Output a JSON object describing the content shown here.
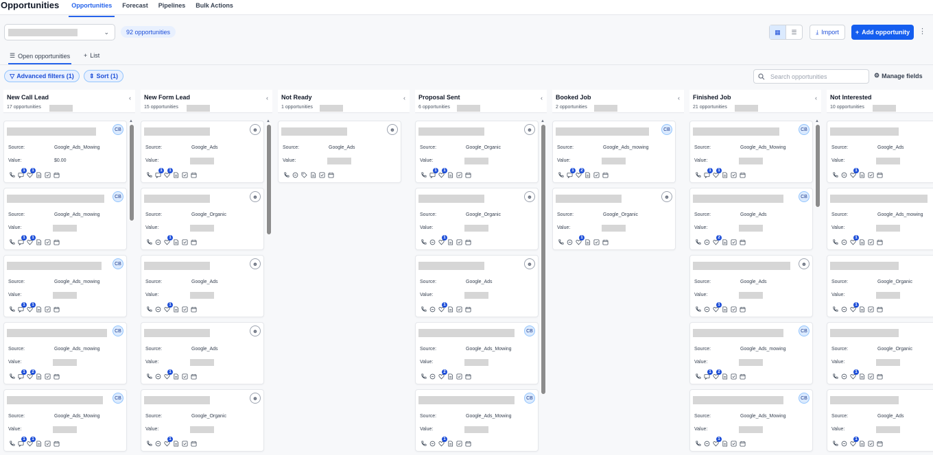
{
  "page_title": "Opportunities",
  "nav_tabs": [
    "Opportunities",
    "Forecast",
    "Pipelines",
    "Bulk Actions"
  ],
  "toolbar": {
    "opportunity_count": "92 opportunities",
    "import_label": "Import",
    "add_label": "Add opportunity"
  },
  "subtabs": {
    "open": "Open opportunities",
    "list": "List"
  },
  "filters": {
    "advanced": "Advanced filters (1)",
    "sort": "Sort (1)",
    "search_placeholder": "Search opportunities",
    "manage": "Manage fields"
  },
  "labels": {
    "source": "Source:",
    "value": "Value:"
  },
  "columns": [
    {
      "name": "New Call Lead",
      "count": "17 opportunities",
      "cards": [
        {
          "avatar": "CB",
          "source": "Google_Ads_Mowing",
          "value": "$0.00",
          "icons": [
            "phone",
            "msg",
            "heart",
            "doc",
            "check",
            "cal"
          ],
          "badges": {
            "msg": "1",
            "heart": "1"
          }
        },
        {
          "avatar": "CB",
          "source": "Google_Ads_mowing",
          "value": "",
          "icons": [
            "phone",
            "msg",
            "heart",
            "doc",
            "check",
            "cal"
          ],
          "badges": {
            "msg": "1",
            "heart": "1"
          }
        },
        {
          "avatar": "CB",
          "source": "Google_Ads_mowing",
          "value": "",
          "icons": [
            "phone",
            "msg",
            "heart",
            "doc",
            "check",
            "cal"
          ],
          "badges": {
            "msg": "1",
            "heart": "1"
          }
        },
        {
          "avatar": "CB",
          "source": "Google_Ads_mowing",
          "value": "",
          "icons": [
            "phone",
            "msg",
            "heart",
            "doc",
            "check",
            "cal"
          ],
          "badges": {
            "msg": "1",
            "heart": "2"
          }
        },
        {
          "avatar": "CB",
          "source": "Google_Ads_Mowing",
          "value": "",
          "icons": [
            "phone",
            "msg",
            "heart",
            "doc",
            "check",
            "cal"
          ],
          "badges": {
            "msg": "1",
            "heart": "1"
          }
        }
      ]
    },
    {
      "name": "New Form Lead",
      "count": "15 opportunities",
      "cards": [
        {
          "avatar": "person",
          "source": "Google_Ads",
          "value": "",
          "icons": [
            "phone",
            "msg",
            "heart",
            "doc",
            "check",
            "cal"
          ],
          "badges": {
            "msg": "1",
            "heart": "1"
          }
        },
        {
          "avatar": "person",
          "source": "Google_Organic",
          "value": "",
          "icons": [
            "phone",
            "chat",
            "heart",
            "doc",
            "check",
            "cal"
          ],
          "badges": {
            "heart": "1"
          }
        },
        {
          "avatar": "person",
          "source": "Google_Ads",
          "value": "",
          "icons": [
            "phone",
            "chat",
            "heart",
            "doc",
            "check",
            "cal"
          ],
          "badges": {
            "heart": "1"
          }
        },
        {
          "avatar": "person",
          "source": "Google_Ads",
          "value": "",
          "icons": [
            "phone",
            "chat",
            "heart",
            "doc",
            "check",
            "cal"
          ],
          "badges": {
            "heart": "1"
          }
        },
        {
          "avatar": "person",
          "source": "Google_Organic",
          "value": "",
          "icons": [
            "phone",
            "chat",
            "heart",
            "doc",
            "check",
            "cal"
          ],
          "badges": {
            "heart": "1"
          }
        }
      ]
    },
    {
      "name": "Not Ready",
      "count": "1 opportunities",
      "cards": [
        {
          "avatar": "person",
          "source": "Google_Ads",
          "value": "",
          "icons": [
            "phone",
            "chat",
            "tag",
            "doc",
            "check",
            "cal"
          ],
          "badges": {}
        }
      ]
    },
    {
      "name": "Proposal Sent",
      "count": "6 opportunities",
      "cards": [
        {
          "avatar": "person",
          "source": "Google_Organic",
          "value": "",
          "icons": [
            "phone",
            "msg",
            "heart",
            "doc",
            "check",
            "cal"
          ],
          "badges": {
            "msg": "1",
            "heart": "1"
          }
        },
        {
          "avatar": "person",
          "source": "Google_Organic",
          "value": "",
          "icons": [
            "phone",
            "chat",
            "heart",
            "doc",
            "check",
            "cal"
          ],
          "badges": {
            "heart": "1"
          }
        },
        {
          "avatar": "person",
          "source": "Google_Ads",
          "value": "",
          "icons": [
            "phone",
            "chat",
            "heart",
            "doc",
            "check",
            "cal"
          ],
          "badges": {
            "heart": "1"
          }
        },
        {
          "avatar": "CB",
          "source": "Google_Ads_Mowing",
          "value": "",
          "icons": [
            "phone",
            "chat",
            "heart",
            "doc",
            "check",
            "cal"
          ],
          "badges": {
            "heart": "2"
          }
        },
        {
          "avatar": "CB",
          "source": "Google_Ads_Mowing",
          "value": "",
          "icons": [
            "phone",
            "chat",
            "heart",
            "doc",
            "check",
            "cal"
          ],
          "badges": {
            "heart": "1"
          }
        }
      ]
    },
    {
      "name": "Booked Job",
      "count": "2 opportunities",
      "cards": [
        {
          "avatar": "CB",
          "source": "Google_Ads_mowing",
          "value": "",
          "icons": [
            "phone",
            "msg",
            "heart",
            "doc",
            "check",
            "cal"
          ],
          "badges": {
            "msg": "1",
            "heart": "2"
          }
        },
        {
          "avatar": "person",
          "source": "Google_Organic",
          "value": "",
          "icons": [
            "phone",
            "chat",
            "heart",
            "doc",
            "check",
            "cal"
          ],
          "badges": {
            "heart": "1"
          }
        }
      ]
    },
    {
      "name": "Finished Job",
      "count": "21 opportunities",
      "cards": [
        {
          "avatar": "CB",
          "source": "Google_Ads_Mowing",
          "value": "",
          "icons": [
            "phone",
            "msg",
            "heart",
            "doc",
            "check",
            "cal"
          ],
          "badges": {
            "msg": "1",
            "heart": "1"
          }
        },
        {
          "avatar": "CB",
          "source": "Google_Ads",
          "value": "",
          "icons": [
            "phone",
            "chat",
            "heart",
            "doc",
            "check",
            "cal"
          ],
          "badges": {
            "heart": "2"
          }
        },
        {
          "avatar": "person",
          "source": "Google_Ads",
          "value": "",
          "icons": [
            "phone",
            "chat",
            "heart",
            "doc",
            "check",
            "cal"
          ],
          "badges": {
            "heart": "1"
          }
        },
        {
          "avatar": "CB",
          "source": "Google_Ads_mowing",
          "value": "",
          "icons": [
            "phone",
            "msg",
            "heart",
            "doc",
            "check",
            "cal"
          ],
          "badges": {
            "msg": "1",
            "heart": "2"
          }
        },
        {
          "avatar": "CB",
          "source": "Google_Ads_Mowing",
          "value": "",
          "icons": [
            "phone",
            "chat",
            "heart",
            "doc",
            "check",
            "cal"
          ],
          "badges": {
            "heart": "1"
          }
        }
      ]
    },
    {
      "name": "Not Interested",
      "count": "10 opportunities",
      "cards": [
        {
          "avatar": "",
          "source": "Google_Ads",
          "value": "",
          "icons": [
            "phone",
            "chat",
            "heart",
            "doc",
            "check",
            "cal"
          ],
          "badges": {
            "heart": "1"
          }
        },
        {
          "avatar": "",
          "source": "Google_Ads_mowing",
          "value": "",
          "icons": [
            "phone",
            "chat",
            "heart",
            "doc",
            "check",
            "cal"
          ],
          "badges": {
            "heart": "1"
          }
        },
        {
          "avatar": "",
          "source": "Google_Organic",
          "value": "",
          "icons": [
            "phone",
            "chat",
            "heart",
            "doc",
            "check",
            "cal"
          ],
          "badges": {
            "heart": "1"
          }
        },
        {
          "avatar": "",
          "source": "Google_Organic",
          "value": "",
          "icons": [
            "phone",
            "chat",
            "heart",
            "doc",
            "check",
            "cal"
          ],
          "badges": {
            "heart": "1"
          }
        },
        {
          "avatar": "",
          "source": "Google_Ads",
          "value": "",
          "icons": [
            "phone",
            "chat",
            "heart",
            "doc",
            "check",
            "cal"
          ],
          "badges": {
            "heart": "1"
          }
        }
      ]
    }
  ]
}
